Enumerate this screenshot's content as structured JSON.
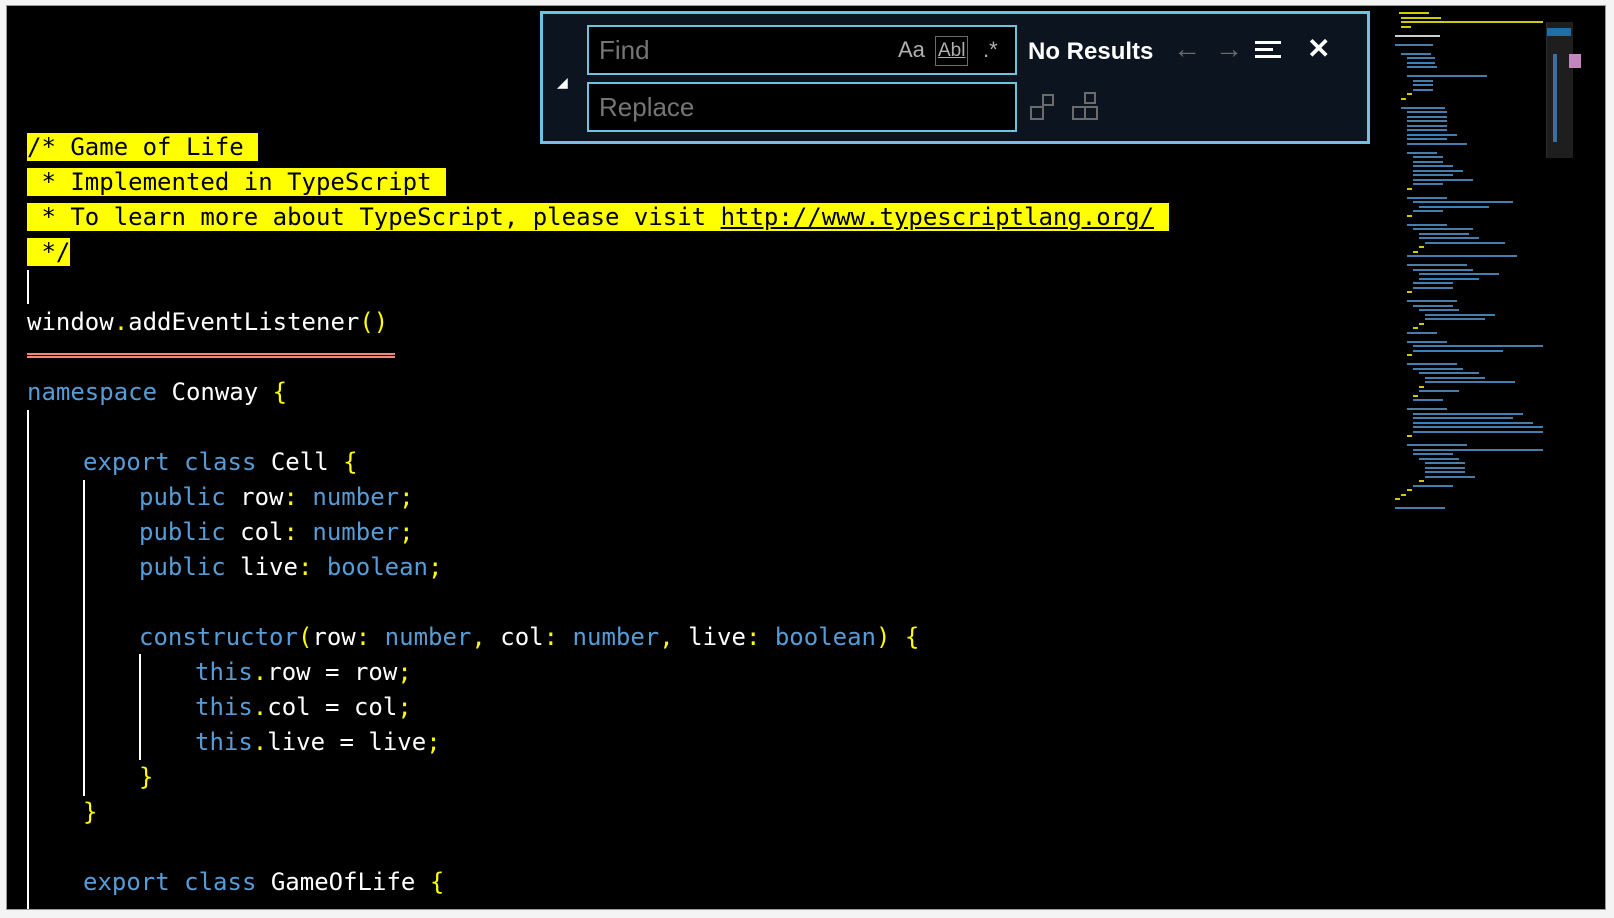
{
  "editor": {
    "comment": [
      "/* Game of Life",
      " * Implemented in TypeScript",
      " * To learn more about TypeScript, please visit ",
      " */"
    ],
    "comment_url": "http://www.typescriptlang.org/",
    "code": {
      "l_window_obj": "window",
      "l_window_dot": ".",
      "l_window_fn": "addEventListener",
      "l_window_paren": "()",
      "l_ns_kw": "namespace",
      "l_ns_name": " Conway ",
      "brace_open": "{",
      "brace_close": "}",
      "l_export": "export",
      "l_class": "class",
      "l_cell": " Cell ",
      "l_public": "public",
      "l_row": " row",
      "l_col": " col",
      "l_live": " live",
      "colon": ":",
      "semi": ";",
      "t_number": "number",
      "t_boolean": "boolean",
      "l_ctor": "constructor",
      "paren_open": "(",
      "paren_close": ")",
      "l_ctor_row": "row",
      "l_ctor_col": "col",
      "l_ctor_live": "live",
      "comma": ",",
      "l_this": "this",
      "dot": ".",
      "eq": " = ",
      "v_row": "row",
      "v_col": "col",
      "v_live": "live",
      "l_gol": "GameOfLife"
    }
  },
  "find_widget": {
    "find_placeholder": "Find",
    "replace_placeholder": "Replace",
    "match_case_label": "Aa",
    "whole_word_label": "Abl",
    "regex_label": ".*",
    "results_text": "No Results",
    "prev_glyph": "←",
    "next_glyph": "→",
    "close_glyph": "✕",
    "toggle_glyph": "◢"
  },
  "colors": {
    "highlight": "#ffff00",
    "keyword": "#569cd6",
    "punctuation": "#ffff00",
    "border_accent": "#6fc3df",
    "error_squiggle": "#f48771"
  }
}
